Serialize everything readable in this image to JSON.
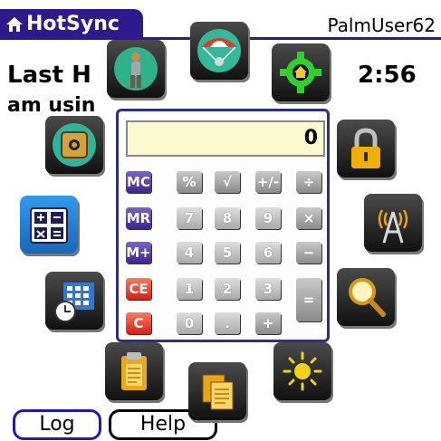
{
  "hotsync": {
    "title": "HotSync",
    "user_name": "PalmUser62",
    "last_line_fragment": "Last H",
    "time_fragment": "2:56",
    "using_fragment": "am usin",
    "log_button": "Log",
    "help_button": "Help"
  },
  "calculator": {
    "display_value": "0",
    "keys": {
      "mc": "MC",
      "mr": "MR",
      "mplus": "M+",
      "ce": "CE",
      "c": "C",
      "percent": "%",
      "sqrt": "√",
      "plusminus": "+/-",
      "divide": "÷",
      "multiply": "×",
      "minus": "−",
      "plus": "+",
      "equals": "=",
      "dot": ".",
      "n0": "0",
      "n1": "1",
      "n2": "2",
      "n3": "3",
      "n4": "4",
      "n5": "5",
      "n6": "6",
      "n7": "7",
      "n8": "8",
      "n9": "9"
    }
  },
  "launcher_icons": [
    "fitness-app-icon",
    "skydiver-app-icon",
    "home-gear-icon",
    "safe-app-icon",
    "lock-icon",
    "calculator-icon",
    "wireless-antenna-icon",
    "calendar-clock-icon",
    "magnifier-icon",
    "memo-clipboard-icon",
    "copy-documents-icon",
    "brightness-icon"
  ],
  "colors": {
    "title_bar": "#2e1a8c",
    "selected_tile": "#2f9bea",
    "memory_keys": "#3d248a",
    "clear_keys": "#d2201a",
    "display_bg": "#fbf9cf"
  }
}
